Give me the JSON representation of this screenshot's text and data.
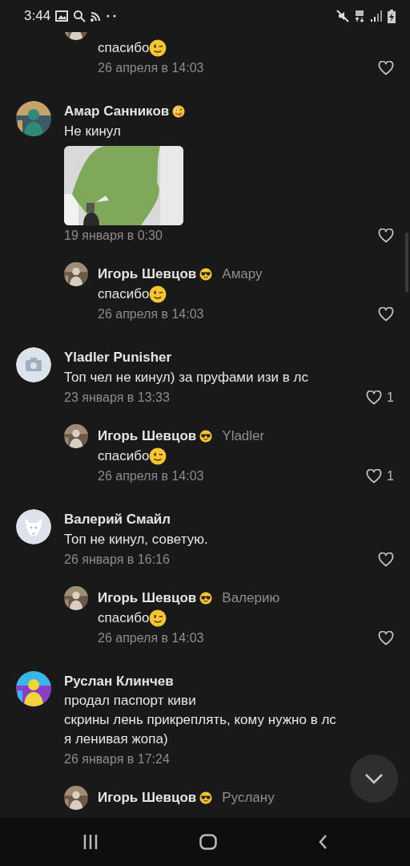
{
  "status_bar": {
    "time": "3:44"
  },
  "comments": [
    {
      "kind": "reply",
      "text": "спасибо",
      "text_emoji": {
        "kind": "wink"
      },
      "date": "26 апреля в 14:03",
      "like_button": true
    },
    {
      "kind": "comment",
      "name": "Амар Санников",
      "name_emoji": {
        "kind": "silly"
      },
      "text": "Не кинул",
      "date": "19 января в 0:30",
      "like_button": true
    },
    {
      "kind": "reply",
      "name": "Игорь Шевцов",
      "name_emoji": {
        "kind": "cool"
      },
      "addressee": "Амару",
      "text": "спасибо",
      "text_emoji": {
        "kind": "wink"
      },
      "date": "26 апреля в 14:03",
      "like_button": true
    },
    {
      "kind": "comment",
      "avatar": {
        "kind": "camera"
      },
      "name": "Yladler Punisher",
      "text": "Топ чел не кинул) за пруфами изи в лс",
      "date": "23 января в 13:33",
      "like_button": true,
      "likes": "1"
    },
    {
      "kind": "reply",
      "name": "Игорь Шевцов",
      "name_emoji": {
        "kind": "cool"
      },
      "addressee": "Yladler",
      "text": "спасибо",
      "text_emoji": {
        "kind": "wink"
      },
      "date": "26 апреля в 14:03",
      "like_button": true,
      "likes": "1"
    },
    {
      "kind": "comment",
      "avatar": {
        "kind": "dog"
      },
      "name": "Валерий Смайл",
      "text": "Топ не кинул, советую.",
      "date": "26 января в 16:16",
      "like_button": true
    },
    {
      "kind": "reply",
      "name": "Игорь Шевцов",
      "name_emoji": {
        "kind": "cool"
      },
      "addressee": "Валерию",
      "text": "спасибо",
      "text_emoji": {
        "kind": "wink"
      },
      "date": "26 апреля в 14:03",
      "like_button": true
    },
    {
      "kind": "comment",
      "name": "Руслан Клинчев",
      "text": "продал паспорт киви\nскрины лень прикреплять, кому нужно в лс\nя ленивая жопа)",
      "date": "26 января в 17:24",
      "like_button": false
    },
    {
      "kind": "reply",
      "name": "Игорь Шевцов",
      "name_emoji": {
        "kind": "cool"
      },
      "addressee": "Руслану"
    }
  ]
}
